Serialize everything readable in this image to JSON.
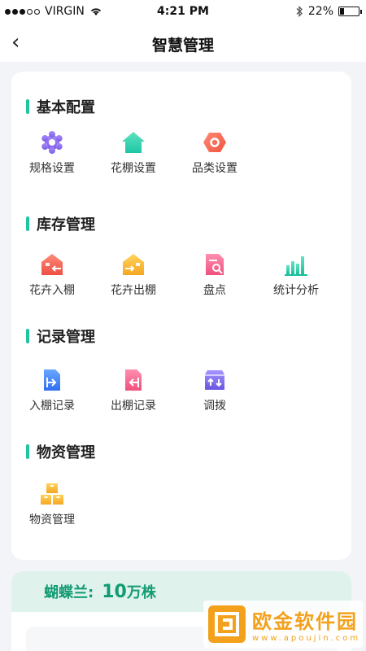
{
  "status": {
    "carrier": "VIRGIN",
    "time": "4:21 PM",
    "battery": "22%",
    "battery_level": 0.22
  },
  "nav": {
    "back_icon": "‹",
    "title": "智慧管理"
  },
  "sections": [
    {
      "title": "基本配置",
      "items": [
        {
          "label": "规格设置",
          "icon": "gear-icon"
        },
        {
          "label": "花棚设置",
          "icon": "greenhouse-icon"
        },
        {
          "label": "品类设置",
          "icon": "hexagon-icon"
        }
      ]
    },
    {
      "title": "库存管理",
      "items": [
        {
          "label": "花卉入棚",
          "icon": "house-in-icon"
        },
        {
          "label": "花卉出棚",
          "icon": "house-out-icon"
        },
        {
          "label": "盘点",
          "icon": "doc-search-icon"
        },
        {
          "label": "统计分析",
          "icon": "bar-chart-icon"
        }
      ]
    },
    {
      "title": "记录管理",
      "items": [
        {
          "label": "入棚记录",
          "icon": "file-in-icon"
        },
        {
          "label": "出棚记录",
          "icon": "file-out-icon"
        },
        {
          "label": "调拨",
          "icon": "transfer-box-icon"
        }
      ]
    },
    {
      "title": "物资管理",
      "items": [
        {
          "label": "物资管理",
          "icon": "boxes-icon"
        }
      ]
    }
  ],
  "stats": {
    "name": "蝴蝶兰:",
    "value": "10",
    "unit": "万株"
  },
  "watermark": {
    "title": "欧金软件园",
    "url": "www.apoujin.com"
  },
  "colors": {
    "accent": "#1fc4a0",
    "stats_bg": "#dff2ec",
    "stats_text": "#139b73",
    "watermark": "#f3a11c"
  }
}
